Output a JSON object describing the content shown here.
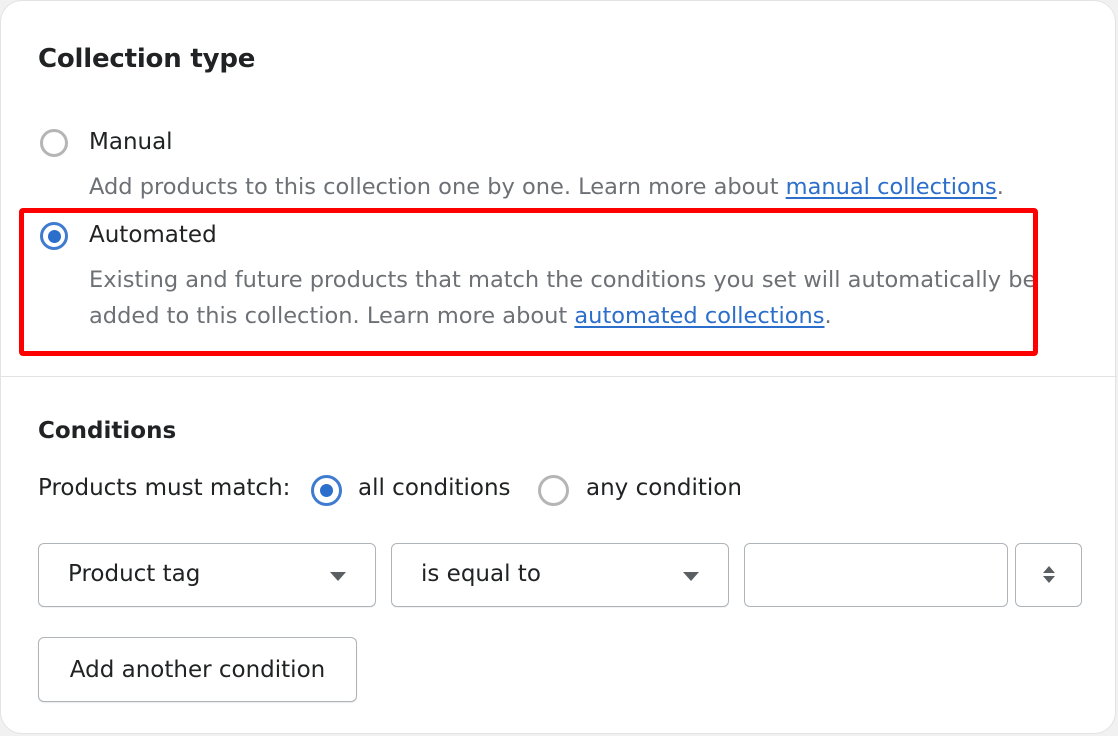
{
  "collection_type": {
    "title": "Collection type",
    "options": [
      {
        "label": "Manual",
        "checked": false,
        "help_prefix": "Add products to this collection one by one. Learn more about ",
        "help_link": "manual collections",
        "help_suffix": "."
      },
      {
        "label": "Automated",
        "checked": true,
        "help_prefix_line1": "Existing and future products that match the conditions you set will automatically be",
        "help_prefix_line2": "added to this collection. Learn more about ",
        "help_link": "automated collections",
        "help_suffix": "."
      }
    ]
  },
  "conditions": {
    "title": "Conditions",
    "match_label": "Products must match:",
    "match_options": [
      {
        "label": "all conditions",
        "checked": true
      },
      {
        "label": "any condition",
        "checked": false
      }
    ],
    "rule": {
      "field": "Product tag",
      "operator": "is equal to",
      "value": "",
      "value_placeholder": ""
    },
    "add_button": "Add another condition"
  },
  "colors": {
    "accent": "#2c6ecb",
    "highlight": "#ff0000",
    "help_text": "#6d7175"
  }
}
